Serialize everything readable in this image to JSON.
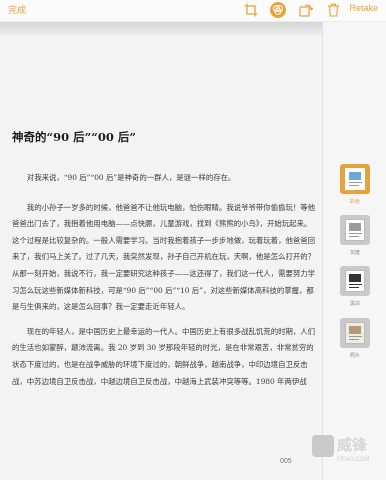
{
  "toolbar": {
    "done_label": "完成",
    "retake_label": "Retake",
    "accent_color": "#e9a23b",
    "icons": [
      "crop-icon",
      "filter-icon",
      "rotate-icon",
      "trash-icon"
    ]
  },
  "document": {
    "title": "神奇的“90 后”“00 后”",
    "paragraphs": [
      "对我来说，“90 后”“00 后”是神奇的一群人，是谜一样的存在。",
      "我的小孙子一岁多的时候，他爸爸不让他玩电脑，怕伤眼睛。我说爷爷带你偷偷玩！等他爸爸出门去了，我抱着他用电脑——点快腮，儿童游戏，找到《熊熊的小鸟》，开始玩起来。这个过程是比较复杂的。一般人需要学习。当时我抱着孩子一步步地做，玩着玩着，他爸爸回来了，我们马上关了。过了几天，我突然发现，孙子自己开机在玩，天啊，他是怎么打开的？从那一刻开始，我说不行，我一定要研究这种孩子——这还得了，我们这一代人，需要努力学习怎么玩这些新媒体新科技，可是“90 后”“00 后”“10 后”，对这些新媒体高科技的掌握，都是与生俱来的，这是怎么回事？我一定要走近年轻人。",
      "现在的年轻人，是中国历史上最幸运的一代人。中国历史上有很多战乱饥荒的时期，人们的生活也如蒙醉，颠沛流离。我 20 岁到 30 岁那段年轻的时光，是在非常艰苦，非常贫穷的状态下度过的，也是在战争威胁的环境下度过的，朝鲜战争，越南战争，中印边境自卫反击战，中苏边境自卫反击战，中越边境自卫反击战，中越海上武装冲突等等。1980 年两伊战"
    ],
    "page_number": "005"
  },
  "filters": [
    {
      "label": "彩色",
      "selected": true
    },
    {
      "label": "灰度",
      "selected": false
    },
    {
      "label": "黑白",
      "selected": false
    },
    {
      "label": "照片",
      "selected": false
    }
  ],
  "watermark": {
    "text": "威锋",
    "sub": "FENG.COM"
  }
}
